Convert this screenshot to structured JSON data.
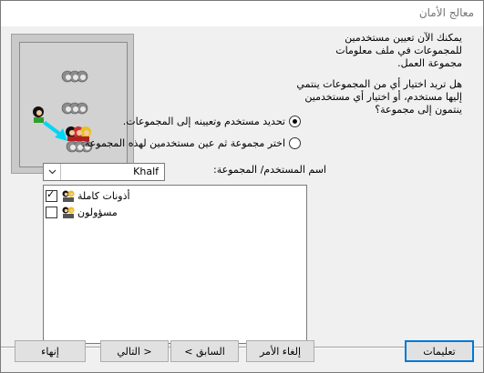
{
  "window": {
    "title": "معالج الأمان"
  },
  "intro_text": "يمكنك الآن تعيين مستخدمين للمجموعات في ملف معلومات مجموعة العمل.",
  "question_text": "هل تريد اختيار أي من المجموعات ينتمي إليها مستخدم، أو اختيار أي مستخدمين ينتمون إلى مجموعة؟",
  "options": [
    {
      "label": "تحديد مستخدم وتعيينه إلى المجموعات.",
      "selected": true
    },
    {
      "label": "اختر مجموعة ثم عين مستخدمين لهذه المجموعة.",
      "selected": false
    }
  ],
  "user_group": {
    "label": "اسم المستخدم/ المجموعة:",
    "value": "Khalf"
  },
  "groups_list": [
    {
      "label": "أذونات كاملة",
      "checked": true,
      "icon": "group-people-icon"
    },
    {
      "label": "مسؤولون",
      "checked": false,
      "icon": "group-people-icon"
    }
  ],
  "buttons": {
    "help": "تعليمات",
    "cancel": "إلغاء الأمر",
    "back": "< السابق",
    "next": "التالي >",
    "finish": "إنهاء"
  },
  "colors": {
    "accent": "#0078d7",
    "illustration_arrow": "#00d7f5"
  }
}
